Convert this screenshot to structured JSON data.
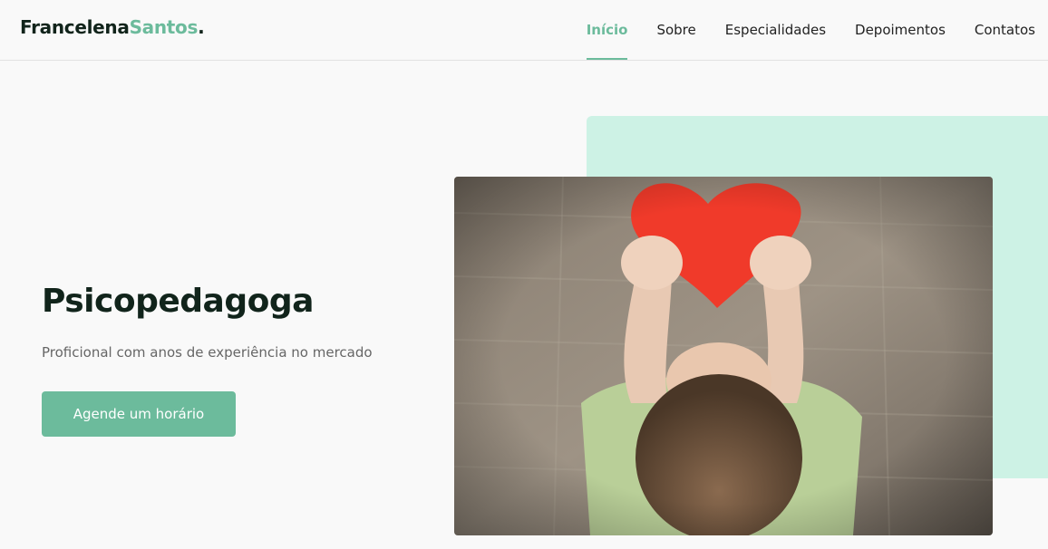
{
  "brand": {
    "name_part1": "Francelena",
    "name_part2": "Santos",
    "dot": "."
  },
  "nav": {
    "items": [
      {
        "label": "Início",
        "active": true
      },
      {
        "label": "Sobre"
      },
      {
        "label": "Especialidades"
      },
      {
        "label": "Depoimentos"
      },
      {
        "label": "Contatos"
      }
    ]
  },
  "hero": {
    "title": "Psicopedagoga",
    "subtitle": "Proficional com anos de experiência no mercado",
    "cta_label": "Agende um horário",
    "image_subject": "child-with-red-paper-heart"
  },
  "colors": {
    "accent": "#6cbb9c",
    "mint": "#cdf2e5",
    "dark": "#11241b"
  }
}
